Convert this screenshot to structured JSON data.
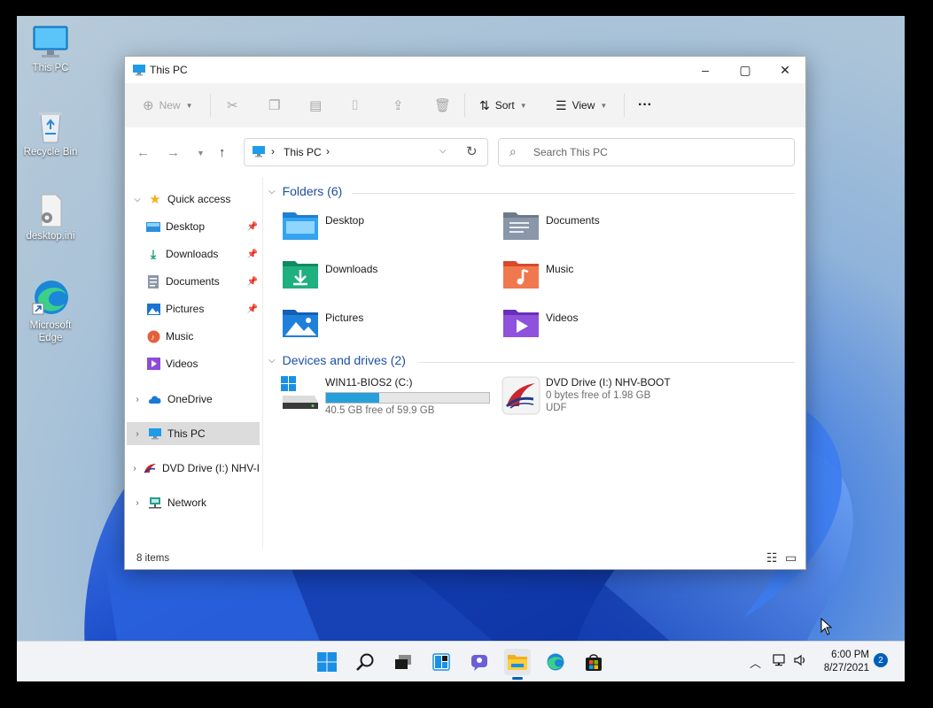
{
  "desktop_icons": [
    {
      "label": "This PC",
      "icon": "monitor-icon"
    },
    {
      "label": "Recycle Bin",
      "icon": "recycle-bin-icon"
    },
    {
      "label": "desktop.ini",
      "icon": "settings-file-icon"
    },
    {
      "label": "Microsoft Edge",
      "icon": "edge-icon"
    }
  ],
  "window": {
    "title": "This PC",
    "controls": {
      "minimize": "–",
      "maximize": "▢",
      "close": "✕"
    }
  },
  "toolbar": {
    "new_label": "New",
    "sort_label": "Sort",
    "view_label": "View",
    "more_label": "···"
  },
  "address": {
    "path_item": "This PC",
    "search_placeholder": "Search This PC"
  },
  "nav": {
    "quick_access": "Quick access",
    "quick_items": [
      {
        "label": "Desktop",
        "icon": "desktop-folder-icon",
        "pinned": true
      },
      {
        "label": "Downloads",
        "icon": "download-icon",
        "pinned": true
      },
      {
        "label": "Documents",
        "icon": "documents-icon",
        "pinned": true
      },
      {
        "label": "Pictures",
        "icon": "pictures-icon",
        "pinned": true
      },
      {
        "label": "Music",
        "icon": "music-icon",
        "pinned": false
      },
      {
        "label": "Videos",
        "icon": "videos-icon",
        "pinned": false
      }
    ],
    "onedrive": "OneDrive",
    "this_pc": "This PC",
    "dvd": "DVD Drive (I:) NHV-I",
    "network": "Network"
  },
  "content": {
    "folders_header": "Folders (6)",
    "folders": [
      {
        "label": "Desktop",
        "icon": "desktop-folder-icon"
      },
      {
        "label": "Documents",
        "icon": "documents-folder-icon"
      },
      {
        "label": "Downloads",
        "icon": "downloads-folder-icon"
      },
      {
        "label": "Music",
        "icon": "music-folder-icon"
      },
      {
        "label": "Pictures",
        "icon": "pictures-folder-icon"
      },
      {
        "label": "Videos",
        "icon": "videos-folder-icon"
      }
    ],
    "devices_header": "Devices and drives (2)",
    "drives": [
      {
        "label": "WIN11-BIOS2 (C:)",
        "free_text": "40.5 GB free of 59.9 GB",
        "used_fraction": 0.324
      },
      {
        "label": "DVD Drive (I:) NHV-BOOT",
        "free_text": "0 bytes free of 1.98 GB",
        "fs": "UDF"
      }
    ]
  },
  "status": {
    "item_count": "8 items"
  },
  "taskbar": {
    "apps": [
      "start-icon",
      "search-icon",
      "task-view-icon",
      "widgets-icon",
      "chat-icon",
      "file-explorer-icon",
      "edge-icon",
      "store-icon"
    ],
    "active_app": "file-explorer-icon",
    "time": "6:00 PM",
    "date": "8/27/2021",
    "notification_count": "2"
  },
  "colors": {
    "accent": "#005fb8",
    "section_header": "#1e4ea8",
    "drive_bar": "#26a0da"
  }
}
